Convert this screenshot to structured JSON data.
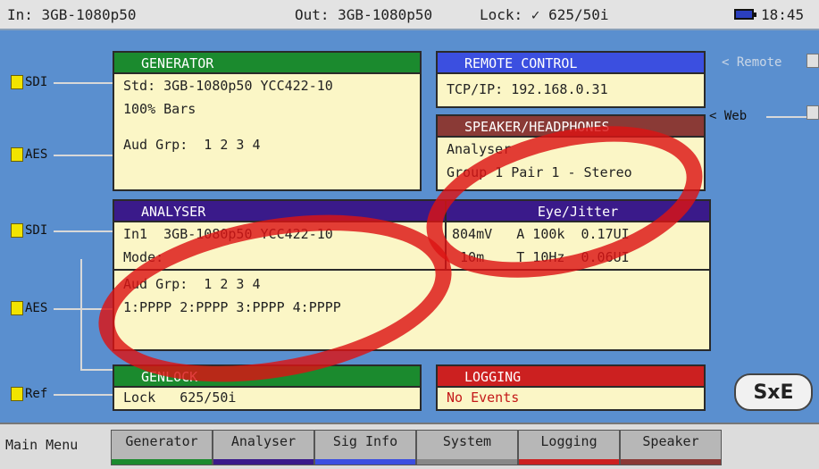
{
  "status": {
    "input": "In: 3GB-1080p50",
    "output": "Out: 3GB-1080p50",
    "lock": "Lock: ✓ 625/50i",
    "time": "18:45"
  },
  "ports_left": {
    "sdi_top": "SDI",
    "aes_top": "AES",
    "sdi_bottom": "SDI",
    "aes_bottom": "AES",
    "ref": "Ref"
  },
  "ports_right": {
    "remote": "< Remote",
    "web": "< Web"
  },
  "generator": {
    "title": "GENERATOR",
    "std": "Std: 3GB-1080p50 YCC422-10",
    "pattern": "100% Bars",
    "aud": "Aud Grp:  1 2 3 4"
  },
  "remote_control": {
    "title": "REMOTE CONTROL",
    "tcp": "TCP/IP: 192.168.0.31"
  },
  "speaker": {
    "title": "SPEAKER/HEADPHONES",
    "line1": "Analyser",
    "line2": "Group 1 Pair 1 - Stereo"
  },
  "analyser": {
    "title": "ANALYSER",
    "in1": "In1  3GB-1080p50 YCC422-10",
    "line2": "Mode:",
    "aud_grp": "Aud Grp:  1 2 3 4",
    "aud_status": "1:PPPP 2:PPPP 3:PPPP 4:PPPP"
  },
  "eye_jitter": {
    "title": "Eye/Jitter",
    "row1": "804mV   A 100k  0.17UI",
    "row2": " 10m    T 10Hz  0.06UI"
  },
  "genlock": {
    "title": "GENLOCK",
    "value": "Lock   625/50i"
  },
  "logging": {
    "title": "LOGGING",
    "value": "No Events"
  },
  "sxe_label": "SxE",
  "menu": {
    "main": "Main Menu",
    "tabs": [
      "Generator",
      "Analyser",
      "Sig Info",
      "System",
      "Logging",
      "Speaker"
    ]
  }
}
